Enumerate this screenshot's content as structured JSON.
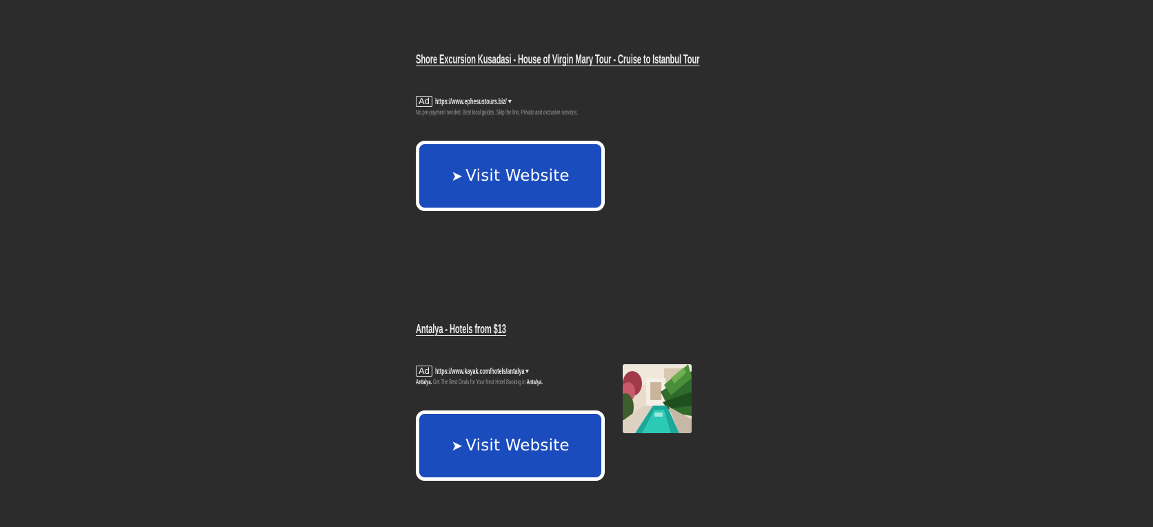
{
  "ads": [
    {
      "title": "Shore Excursion Kusadasi - House of Virgin Mary Tour - Cruise to Istanbul Tour",
      "badge": "Ad",
      "url": "https://www.ephesustours.biz/",
      "description": "No pre-payment needed. Best local guides. Skip the line. Private and exclusive services.",
      "button_label": "Visit Website",
      "button_icon": "arrow-right-icon"
    },
    {
      "title": "Antalya - Hotels from $13",
      "badge": "Ad",
      "url": "https://www.kayak.com/hotels/antalya",
      "description_parts": {
        "lead": "Antalya.",
        "body": " Get The Best Deals for Your Next Hotel Booking in ",
        "tail": "Antalya."
      },
      "button_label": "Visit Website",
      "button_icon": "arrow-right-icon",
      "thumbnail": "hotel-pool-thumbnail"
    }
  ],
  "colors": {
    "page_background": "#2c2c2c",
    "button_background": "#1b4cbd",
    "button_border": "#ffffff",
    "text": "#ececec",
    "muted_text": "#9a9a9a"
  }
}
